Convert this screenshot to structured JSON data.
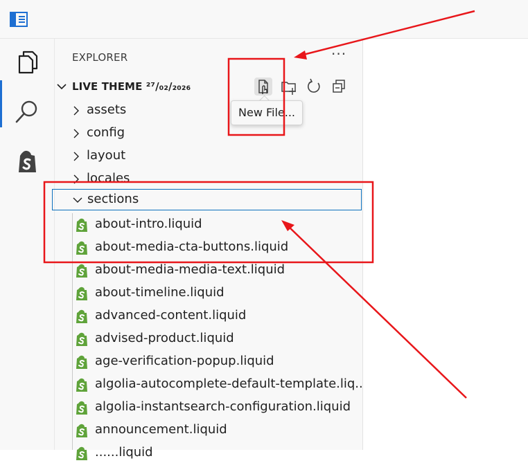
{
  "explorer": {
    "title": "EXPLORER",
    "more_label": "···",
    "root_folder": "LIVE THEME ²⁷/₀₂/₂₀₂₆",
    "tooltip": "New File...",
    "toolbar_icons": [
      "new-file-icon",
      "new-folder-icon",
      "refresh-icon",
      "collapse-all-icon"
    ]
  },
  "activity_bar": {
    "icons": [
      "explorer-files-icon",
      "search-icon",
      "shopify-icon"
    ]
  },
  "folders": [
    {
      "label": "assets",
      "expanded": false
    },
    {
      "label": "config",
      "expanded": false
    },
    {
      "label": "layout",
      "expanded": false
    },
    {
      "label": "locales",
      "expanded": false
    },
    {
      "label": "sections",
      "expanded": true
    }
  ],
  "files": [
    "about-intro.liquid",
    "about-media-cta-buttons.liquid",
    "about-media-media-text.liquid",
    "about-timeline.liquid",
    "advanced-content.liquid",
    "advised-product.liquid",
    "age-verification-popup.liquid",
    "algolia-autocomplete-default-template.liq...",
    "algolia-instantsearch-configuration.liquid",
    "announcement.liquid",
    "......liquid"
  ],
  "colors": {
    "accent": "#1e6fd2",
    "shopify_green": "#5fa33a",
    "annotation_red": "#e8161a",
    "selection_border": "#0a6fbd"
  }
}
